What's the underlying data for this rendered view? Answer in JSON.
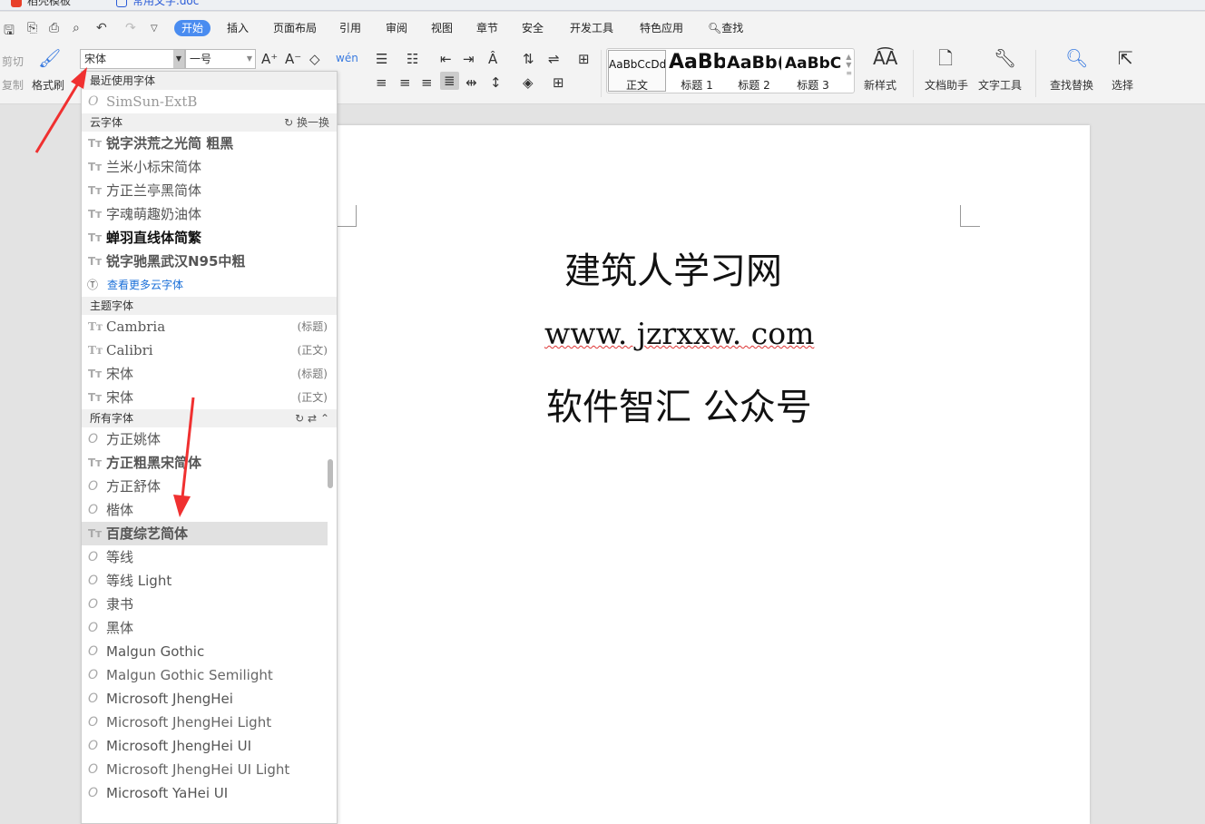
{
  "tabs": [
    {
      "label": "稻壳模板"
    },
    {
      "label": "常用文字.doc"
    }
  ],
  "menu": {
    "items": [
      "开始",
      "插入",
      "页面布局",
      "引用",
      "审阅",
      "视图",
      "章节",
      "安全",
      "开发工具",
      "特色应用"
    ],
    "active": "开始",
    "search": "查找"
  },
  "ribbon": {
    "cut": "剪切",
    "copy": "复制",
    "format_painter": "格式刷",
    "font_name": "宋体",
    "font_size": "一号",
    "styles": [
      {
        "preview": "AaBbCcDd",
        "label": "正文"
      },
      {
        "preview": "AaBb",
        "label": "标题 1"
      },
      {
        "preview": "AaBb(",
        "label": "标题 2"
      },
      {
        "preview": "AaBbC(",
        "label": "标题 3"
      }
    ],
    "new_style": "新样式",
    "doc_helper": "文档助手",
    "text_tools": "文字工具",
    "find_replace": "查找替换",
    "select": "选择"
  },
  "font_dropdown": {
    "recent_header": "最近使用字体",
    "recent": [
      "SimSun-ExtB"
    ],
    "cloud_header": "云字体",
    "cloud_refresh": "换一换",
    "cloud": [
      "锐字洪荒之光简 粗黑",
      "兰米小标宋简体",
      "方正兰亭黑简体",
      "字魂萌趣奶油体",
      "蝉羽直线体简繁",
      "锐字驰黑武汉N95中粗"
    ],
    "more_cloud": "查看更多云字体",
    "theme_header": "主题字体",
    "theme": [
      {
        "name": "Cambria",
        "tag": "(标题)"
      },
      {
        "name": "Calibri",
        "tag": "(正文)"
      },
      {
        "name": "宋体",
        "tag": "(标题)"
      },
      {
        "name": "宋体",
        "tag": "(正文)"
      }
    ],
    "all_header": "所有字体",
    "all": [
      {
        "name": "方正姚体",
        "type": "o"
      },
      {
        "name": "方正粗黑宋简体",
        "type": "t"
      },
      {
        "name": "方正舒体",
        "type": "o"
      },
      {
        "name": "楷体",
        "type": "o"
      },
      {
        "name": "百度综艺简体",
        "type": "t",
        "highlighted": true
      },
      {
        "name": "等线",
        "type": "o"
      },
      {
        "name": "等线 Light",
        "type": "o"
      },
      {
        "name": "隶书",
        "type": "o"
      },
      {
        "name": "黑体",
        "type": "o"
      },
      {
        "name": "Malgun Gothic",
        "type": "o"
      },
      {
        "name": "Malgun Gothic Semilight",
        "type": "o"
      },
      {
        "name": "Microsoft JhengHei",
        "type": "o"
      },
      {
        "name": "Microsoft JhengHei Light",
        "type": "o"
      },
      {
        "name": "Microsoft JhengHei UI",
        "type": "o"
      },
      {
        "name": "Microsoft JhengHei UI Light",
        "type": "o"
      },
      {
        "name": "Microsoft YaHei UI",
        "type": "o"
      }
    ]
  },
  "document": {
    "lines": [
      "建筑人学习网",
      "www. jzrxxw. com",
      "软件智汇  公众号"
    ]
  },
  "colors": {
    "accent": "#4a8cf0",
    "arrow": "#f03030",
    "link": "#1a6fd8"
  }
}
